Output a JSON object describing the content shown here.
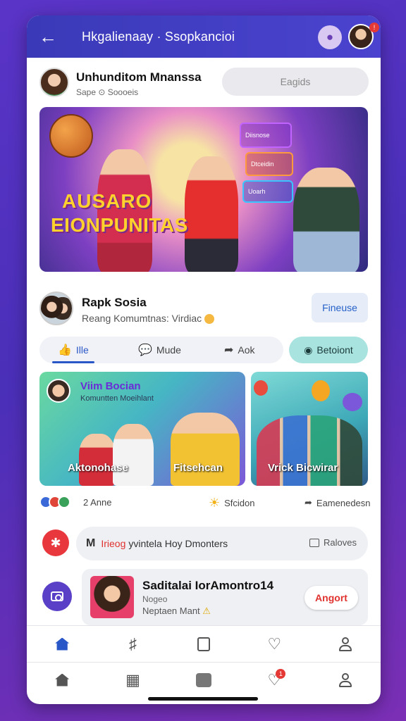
{
  "header": {
    "title": "Hkgalienaay · Ssopkancioi",
    "back_icon": "arrow-left-icon",
    "bulb_icon": "lightbulb-icon",
    "notif_badge": "!"
  },
  "post": {
    "author": "Unhunditom Mnanssa",
    "sub": "Sape ⊙ Soooeis",
    "pill_label": "Eagids"
  },
  "banner": {
    "line1": "AUSARO",
    "line2": "EIONPUNITAS",
    "neon1": "Diisnose",
    "neon2": "Dtceidin",
    "neon3": "Uoarh"
  },
  "user2": {
    "name": "Rapk Sosia",
    "sub": "Reang Komumtnas: Virdiac",
    "follow_label": "Fineuse"
  },
  "actions": {
    "like": "Ille",
    "comment": "Mude",
    "share": "Aok",
    "support": "Betoiont"
  },
  "cards": {
    "card1_title": "Viim Bocian",
    "card1_sub": "Komuntten Moeihlant",
    "card1_label_left": "Aktonohase",
    "card1_label_right": "Fitsehcan",
    "card2_label": "Vrick Bicwirar"
  },
  "stats": {
    "likes": "2 Anne",
    "mid": "Sfcidon",
    "right": "Eamenedesn"
  },
  "compose": {
    "text_prefix": "Irieog",
    "text_main": "yvintela Hoy Dmonters",
    "right_label": "Raloves"
  },
  "promo": {
    "title": "Saditalai IorAmontro14",
    "sub1": "Nogeo",
    "sub2": "Neptaen Mant",
    "button": "Angort"
  },
  "nav": {
    "row1": [
      "home-icon",
      "bookmark-icon",
      "edit-icon",
      "heart-icon",
      "profile-icon"
    ],
    "row2": [
      "home-icon",
      "camera-save-icon",
      "square-icon",
      "heart-icon",
      "profile-icon"
    ],
    "badge": "1"
  },
  "colors": {
    "accent": "#2a57c7",
    "header": "#3a3ab8",
    "support": "#a9e3e0",
    "promo_button_text": "#e0322f"
  }
}
